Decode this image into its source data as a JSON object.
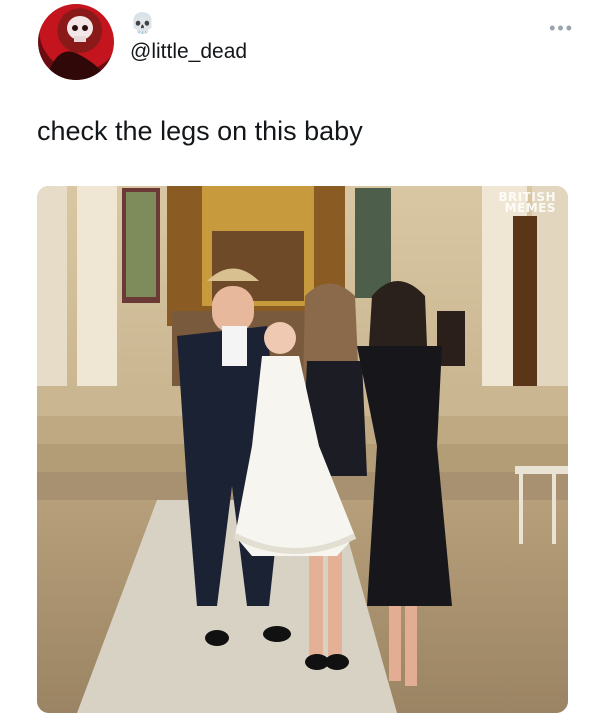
{
  "post": {
    "skull_emoji": "💀",
    "handle": "@little_dead",
    "more_icon": "•••",
    "text": "check the legs on this baby"
  },
  "media": {
    "description": "",
    "watermark": {
      "line1": "BRITISH",
      "line2": "MEMES"
    }
  }
}
